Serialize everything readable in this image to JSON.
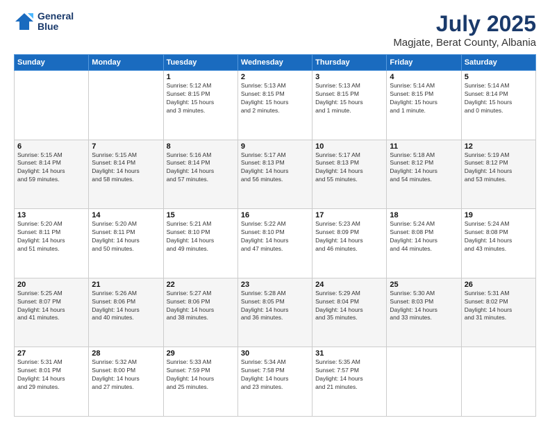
{
  "header": {
    "logo_line1": "General",
    "logo_line2": "Blue",
    "title": "July 2025",
    "subtitle": "Magjate, Berat County, Albania"
  },
  "weekdays": [
    "Sunday",
    "Monday",
    "Tuesday",
    "Wednesday",
    "Thursday",
    "Friday",
    "Saturday"
  ],
  "weeks": [
    [
      {
        "day": "",
        "info": ""
      },
      {
        "day": "",
        "info": ""
      },
      {
        "day": "1",
        "info": "Sunrise: 5:12 AM\nSunset: 8:15 PM\nDaylight: 15 hours\nand 3 minutes."
      },
      {
        "day": "2",
        "info": "Sunrise: 5:13 AM\nSunset: 8:15 PM\nDaylight: 15 hours\nand 2 minutes."
      },
      {
        "day": "3",
        "info": "Sunrise: 5:13 AM\nSunset: 8:15 PM\nDaylight: 15 hours\nand 1 minute."
      },
      {
        "day": "4",
        "info": "Sunrise: 5:14 AM\nSunset: 8:15 PM\nDaylight: 15 hours\nand 1 minute."
      },
      {
        "day": "5",
        "info": "Sunrise: 5:14 AM\nSunset: 8:14 PM\nDaylight: 15 hours\nand 0 minutes."
      }
    ],
    [
      {
        "day": "6",
        "info": "Sunrise: 5:15 AM\nSunset: 8:14 PM\nDaylight: 14 hours\nand 59 minutes."
      },
      {
        "day": "7",
        "info": "Sunrise: 5:15 AM\nSunset: 8:14 PM\nDaylight: 14 hours\nand 58 minutes."
      },
      {
        "day": "8",
        "info": "Sunrise: 5:16 AM\nSunset: 8:14 PM\nDaylight: 14 hours\nand 57 minutes."
      },
      {
        "day": "9",
        "info": "Sunrise: 5:17 AM\nSunset: 8:13 PM\nDaylight: 14 hours\nand 56 minutes."
      },
      {
        "day": "10",
        "info": "Sunrise: 5:17 AM\nSunset: 8:13 PM\nDaylight: 14 hours\nand 55 minutes."
      },
      {
        "day": "11",
        "info": "Sunrise: 5:18 AM\nSunset: 8:12 PM\nDaylight: 14 hours\nand 54 minutes."
      },
      {
        "day": "12",
        "info": "Sunrise: 5:19 AM\nSunset: 8:12 PM\nDaylight: 14 hours\nand 53 minutes."
      }
    ],
    [
      {
        "day": "13",
        "info": "Sunrise: 5:20 AM\nSunset: 8:11 PM\nDaylight: 14 hours\nand 51 minutes."
      },
      {
        "day": "14",
        "info": "Sunrise: 5:20 AM\nSunset: 8:11 PM\nDaylight: 14 hours\nand 50 minutes."
      },
      {
        "day": "15",
        "info": "Sunrise: 5:21 AM\nSunset: 8:10 PM\nDaylight: 14 hours\nand 49 minutes."
      },
      {
        "day": "16",
        "info": "Sunrise: 5:22 AM\nSunset: 8:10 PM\nDaylight: 14 hours\nand 47 minutes."
      },
      {
        "day": "17",
        "info": "Sunrise: 5:23 AM\nSunset: 8:09 PM\nDaylight: 14 hours\nand 46 minutes."
      },
      {
        "day": "18",
        "info": "Sunrise: 5:24 AM\nSunset: 8:08 PM\nDaylight: 14 hours\nand 44 minutes."
      },
      {
        "day": "19",
        "info": "Sunrise: 5:24 AM\nSunset: 8:08 PM\nDaylight: 14 hours\nand 43 minutes."
      }
    ],
    [
      {
        "day": "20",
        "info": "Sunrise: 5:25 AM\nSunset: 8:07 PM\nDaylight: 14 hours\nand 41 minutes."
      },
      {
        "day": "21",
        "info": "Sunrise: 5:26 AM\nSunset: 8:06 PM\nDaylight: 14 hours\nand 40 minutes."
      },
      {
        "day": "22",
        "info": "Sunrise: 5:27 AM\nSunset: 8:06 PM\nDaylight: 14 hours\nand 38 minutes."
      },
      {
        "day": "23",
        "info": "Sunrise: 5:28 AM\nSunset: 8:05 PM\nDaylight: 14 hours\nand 36 minutes."
      },
      {
        "day": "24",
        "info": "Sunrise: 5:29 AM\nSunset: 8:04 PM\nDaylight: 14 hours\nand 35 minutes."
      },
      {
        "day": "25",
        "info": "Sunrise: 5:30 AM\nSunset: 8:03 PM\nDaylight: 14 hours\nand 33 minutes."
      },
      {
        "day": "26",
        "info": "Sunrise: 5:31 AM\nSunset: 8:02 PM\nDaylight: 14 hours\nand 31 minutes."
      }
    ],
    [
      {
        "day": "27",
        "info": "Sunrise: 5:31 AM\nSunset: 8:01 PM\nDaylight: 14 hours\nand 29 minutes."
      },
      {
        "day": "28",
        "info": "Sunrise: 5:32 AM\nSunset: 8:00 PM\nDaylight: 14 hours\nand 27 minutes."
      },
      {
        "day": "29",
        "info": "Sunrise: 5:33 AM\nSunset: 7:59 PM\nDaylight: 14 hours\nand 25 minutes."
      },
      {
        "day": "30",
        "info": "Sunrise: 5:34 AM\nSunset: 7:58 PM\nDaylight: 14 hours\nand 23 minutes."
      },
      {
        "day": "31",
        "info": "Sunrise: 5:35 AM\nSunset: 7:57 PM\nDaylight: 14 hours\nand 21 minutes."
      },
      {
        "day": "",
        "info": ""
      },
      {
        "day": "",
        "info": ""
      }
    ]
  ]
}
